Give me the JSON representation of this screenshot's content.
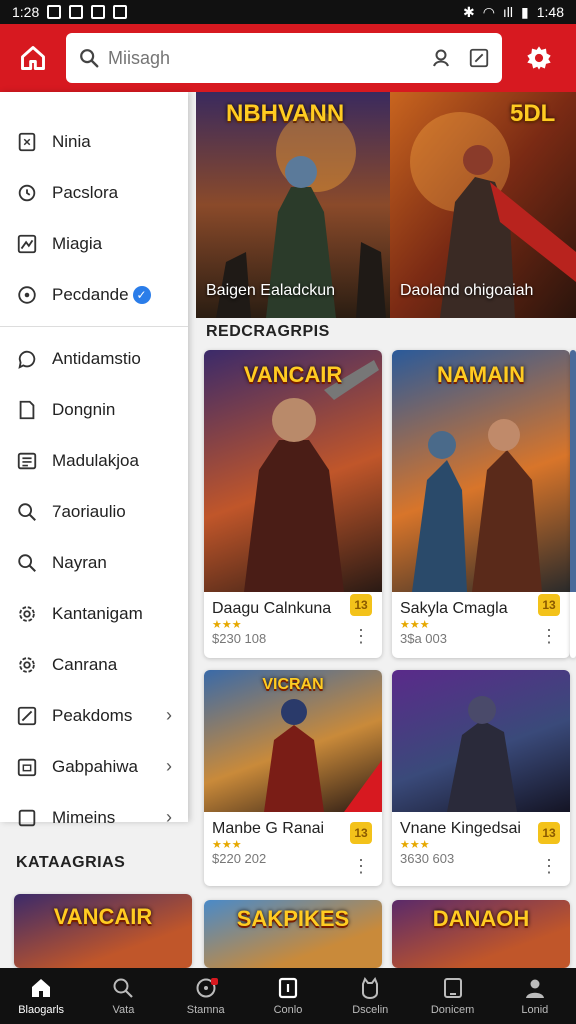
{
  "status_bar": {
    "time_left": "1:28",
    "time_right": "1:48",
    "signal": "ıll"
  },
  "search": {
    "placeholder": "Miisagh"
  },
  "drawer": {
    "items_top": [
      {
        "label": "Ninia",
        "icon": "bookmark-icon"
      },
      {
        "label": "Pacslora",
        "icon": "refresh-icon"
      },
      {
        "label": "Miagia",
        "icon": "image-icon"
      },
      {
        "label": "Pecdande",
        "icon": "info-icon",
        "verified": true
      }
    ],
    "items_bottom": [
      {
        "label": "Antidamstio",
        "icon": "chat-icon"
      },
      {
        "label": "Dongnin",
        "icon": "file-icon"
      },
      {
        "label": "Madulakjoa",
        "icon": "list-icon"
      },
      {
        "label": "7aoriaulio",
        "icon": "search-icon"
      },
      {
        "label": "Nayran",
        "icon": "search-icon"
      },
      {
        "label": "Kantanigam",
        "icon": "gear-icon"
      },
      {
        "label": "Canrana",
        "icon": "gear-icon"
      },
      {
        "label": "Peakdoms",
        "icon": "percent-icon",
        "chevron": true
      },
      {
        "label": "Gabpahiwa",
        "icon": "calendar-icon",
        "chevron": true
      },
      {
        "label": "Mimeins",
        "icon": "square-icon",
        "chevron": true
      }
    ],
    "chevron": "›",
    "verified_glyph": "✓"
  },
  "banners": [
    {
      "title": "NBHVANN",
      "caption": "Baigen Ealadckun"
    },
    {
      "title": "5DL",
      "caption": "Daoland ohigoaiah"
    }
  ],
  "sections": {
    "main": "REDCRAGRPIS",
    "categories": "KATAAGRIAS"
  },
  "cards": [
    {
      "art_title": "VANCAIR",
      "name": "Daagu Calnkuna",
      "stars": "★★★",
      "meta": "$230 108",
      "badge": "13"
    },
    {
      "art_title": "NAMAIN",
      "name": "Sakyla Cmagla",
      "stars": "★★★",
      "meta": "3$a 003",
      "badge": "13"
    },
    {
      "art_title": "VICRAN",
      "name": "Manbe G Ranai",
      "stars": "★★★",
      "meta": "$220 202",
      "badge": "13"
    },
    {
      "art_title": "",
      "name": "Vnane Kingedsai",
      "stars": "★★★",
      "meta": "3630 603",
      "badge": "13"
    },
    {
      "art_title": "VANCAIR",
      "name": "",
      "stars": "",
      "meta": "",
      "badge": ""
    },
    {
      "art_title": "SAKPIKES",
      "name": "",
      "stars": "",
      "meta": "",
      "badge": ""
    },
    {
      "art_title": "DANAOH",
      "name": "",
      "stars": "",
      "meta": "",
      "badge": ""
    }
  ],
  "bottom_nav": [
    {
      "label": "Blaogarls",
      "icon": "home-icon",
      "active": true
    },
    {
      "label": "Vata",
      "icon": "search-icon"
    },
    {
      "label": "Stamna",
      "icon": "compass-icon"
    },
    {
      "label": "Conlo",
      "icon": "square-icon"
    },
    {
      "label": "Dscelin",
      "icon": "cat-icon"
    },
    {
      "label": "Donicem",
      "icon": "tablet-icon"
    },
    {
      "label": "Lonid",
      "icon": "person-icon"
    }
  ],
  "colors": {
    "brand": "#d71920",
    "nav_bg": "#111111",
    "badge": "#f3c21a",
    "star": "#e6a800"
  }
}
